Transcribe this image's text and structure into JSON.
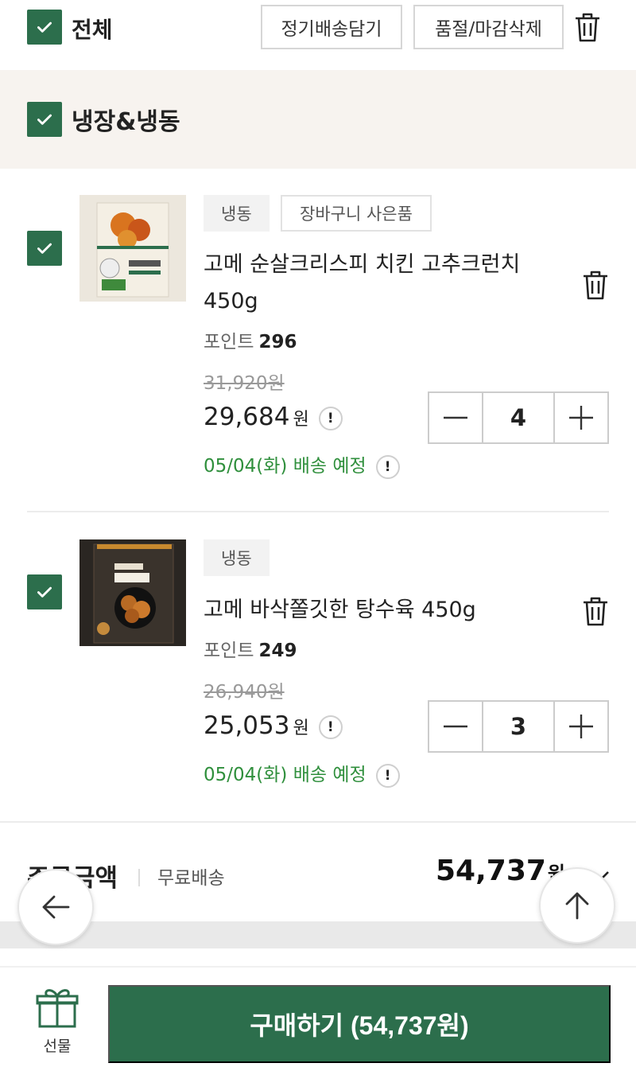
{
  "toolbar": {
    "select_all_label": "전체",
    "subscription_button": "정기배송담기",
    "soldout_delete_button": "품절/마감삭제"
  },
  "category": {
    "label": "냉장&냉동"
  },
  "items": [
    {
      "tags": [
        "냉동",
        "장바구니 사은품"
      ],
      "name_line1": "고메 순살크리스피 치킨 고추크런치",
      "name_line2": "450g",
      "points_label": "포인트",
      "points": "296",
      "original_price": "31,920원",
      "price": "29,684",
      "currency": "원",
      "delivery": "05/04(화) 배송 예정",
      "quantity": "4"
    },
    {
      "tags": [
        "냉동"
      ],
      "name_line1": "고메 바삭쫄깃한 탕수육 450g",
      "points_label": "포인트",
      "points": "249",
      "original_price": "26,940원",
      "price": "25,053",
      "currency": "원",
      "delivery": "05/04(화) 배송 예정",
      "quantity": "3"
    }
  ],
  "summary": {
    "title": "주문금액",
    "shipping": "무료배송",
    "total": "54,737",
    "currency": "원"
  },
  "bottom": {
    "gift_label": "선물",
    "buy_button": "구매하기 (54,737원)"
  },
  "colors": {
    "brand_green": "#2c6e4c",
    "delivery_green": "#2f8f3c",
    "category_bg": "#f7f3ef"
  },
  "icons": [
    "check-icon",
    "trash-icon",
    "info-icon",
    "minus-icon",
    "plus-icon",
    "back-arrow-icon",
    "up-arrow-icon",
    "gift-icon",
    "chevron-down-icon"
  ]
}
